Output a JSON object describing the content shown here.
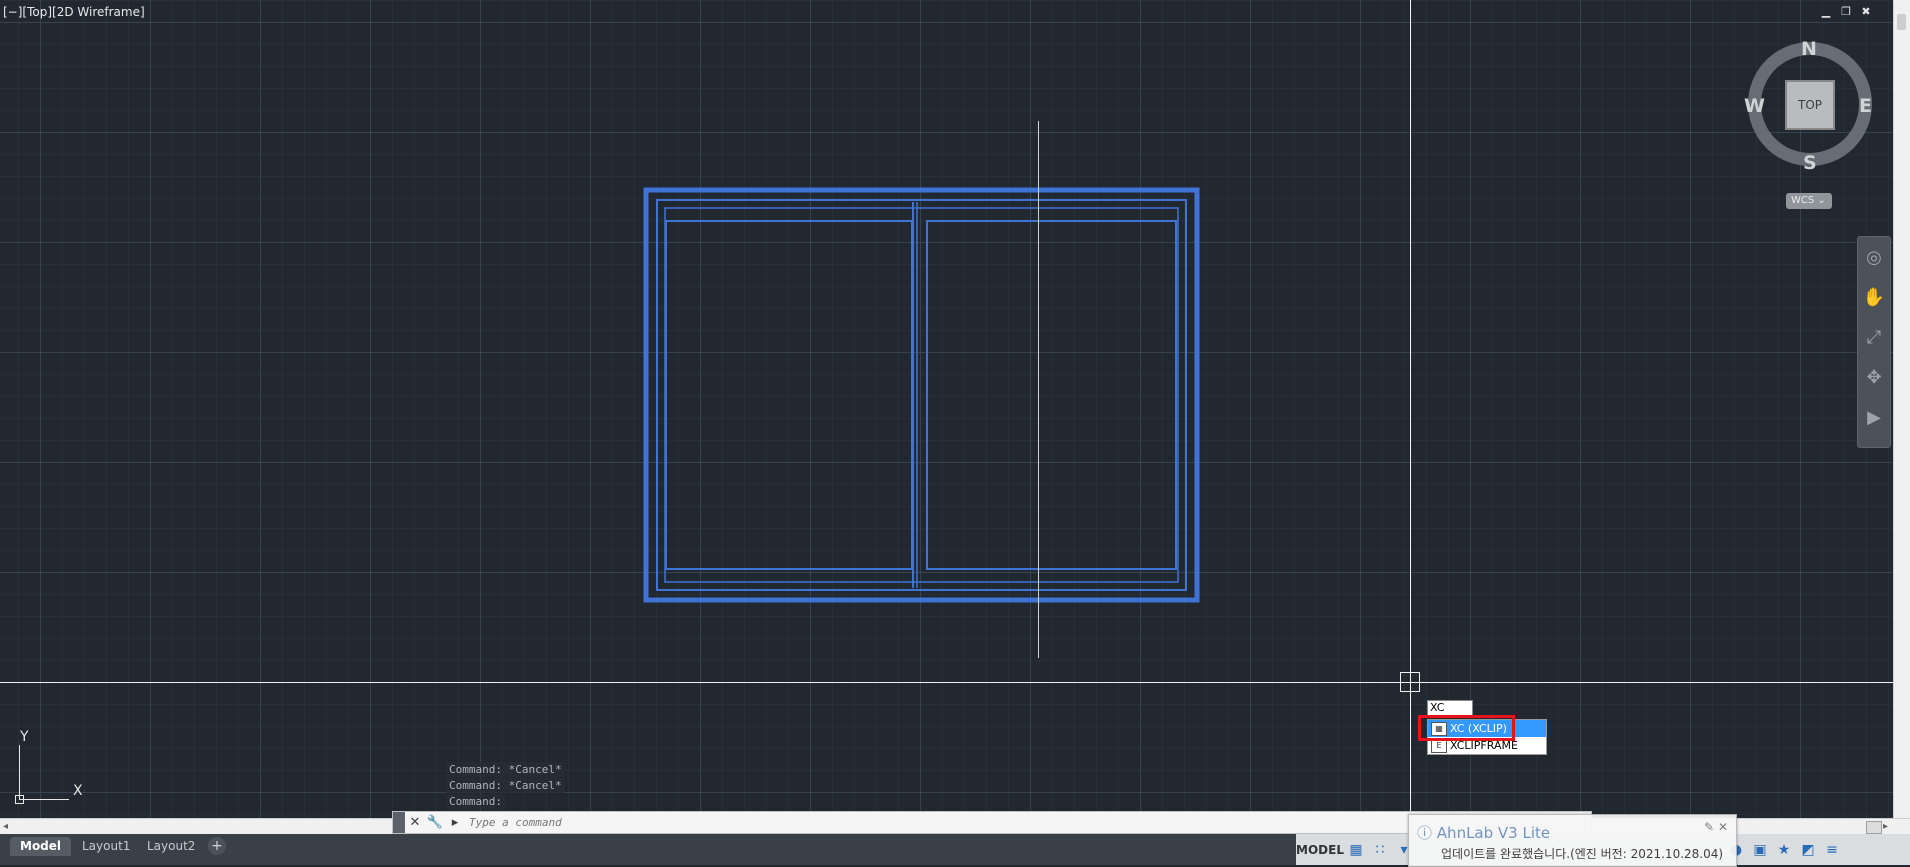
{
  "viewport": {
    "label": "[−][Top][2D Wireframe]"
  },
  "window_controls": {
    "minimize": "▁",
    "restore": "❐",
    "close": "✖"
  },
  "viewcube": {
    "north": "N",
    "south": "S",
    "east": "E",
    "west": "W",
    "face": "TOP",
    "wcs_label": "WCS ⌄"
  },
  "ucs": {
    "x_label": "X",
    "y_label": "Y"
  },
  "command": {
    "history": [
      "Command: *Cancel*",
      "Command: *Cancel*",
      "Command:"
    ],
    "placeholder": "Type a command",
    "close_glyph": "✕",
    "customize_glyph": "🔧",
    "prompt_glyph": "▸"
  },
  "autocomplete": {
    "typed": "XC",
    "items": [
      {
        "label": "XC (XCLIP)",
        "icon_glyph": "▦"
      },
      {
        "label": "XCLIPFRAME",
        "icon_glyph": "E"
      }
    ]
  },
  "notification": {
    "title": "AhnLab V3 Lite",
    "message": "업데이트를 완료했습니다.(엔진 버전: 2021.10.28.04)",
    "pin_glyph": "✎",
    "close_glyph": "✕"
  },
  "tabs": [
    "Model",
    "Layout1",
    "Layout2"
  ],
  "tab_add": "+",
  "status": {
    "model": "MODEL",
    "icons": [
      "▦",
      "∷",
      "▾",
      "+",
      "⬚",
      "●",
      "▣",
      "★",
      "◩",
      "≡"
    ]
  },
  "colors": {
    "background": "#212830",
    "drawing_blue": "#3f74d6",
    "crosshair": "#f2f2f2",
    "selection": "#3399ff",
    "highlight_red": "#e8141b"
  }
}
